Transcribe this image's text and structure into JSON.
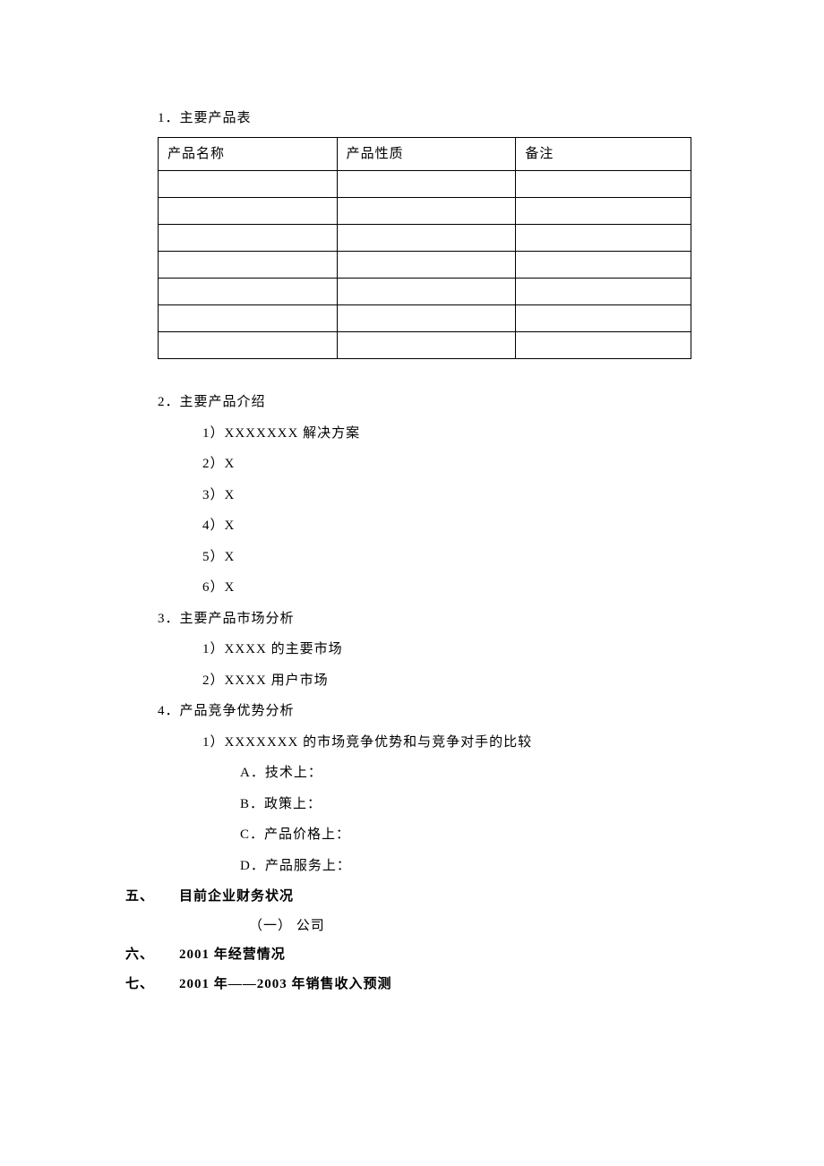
{
  "s1": {
    "title": "1．主要产品表",
    "table": {
      "headers": [
        "产品名称",
        "产品性质",
        "备注"
      ],
      "rows": [
        [
          "",
          "",
          ""
        ],
        [
          "",
          "",
          ""
        ],
        [
          "",
          "",
          ""
        ],
        [
          "",
          "",
          ""
        ],
        [
          "",
          "",
          ""
        ],
        [
          "",
          "",
          ""
        ],
        [
          "",
          "",
          ""
        ]
      ]
    }
  },
  "s2": {
    "title": "2．主要产品介绍",
    "items": [
      "1）XXXXXXX 解决方案",
      "2）X",
      "3）X",
      "4）X",
      "5）X",
      "6）X"
    ]
  },
  "s3": {
    "title": "3．主要产品市场分析",
    "items": [
      "1）XXXX 的主要市场",
      "2）XXXX 用户市场"
    ]
  },
  "s4": {
    "title": "4．产品竞争优势分析",
    "sub": "1）XXXXXXX 的市场竞争优势和与竞争对手的比较",
    "points": [
      "A．技术上：",
      "B．政策上：",
      "C．产品价格上：",
      "D．产品服务上："
    ]
  },
  "h5": {
    "num": "五、",
    "txt": "目前企业财务状况",
    "sub": "（一） 公司"
  },
  "h6": {
    "num": "六、",
    "txt": "2001 年经营情况"
  },
  "h7": {
    "num": "七、",
    "txt": "2001 年——2003 年销售收入预测"
  }
}
